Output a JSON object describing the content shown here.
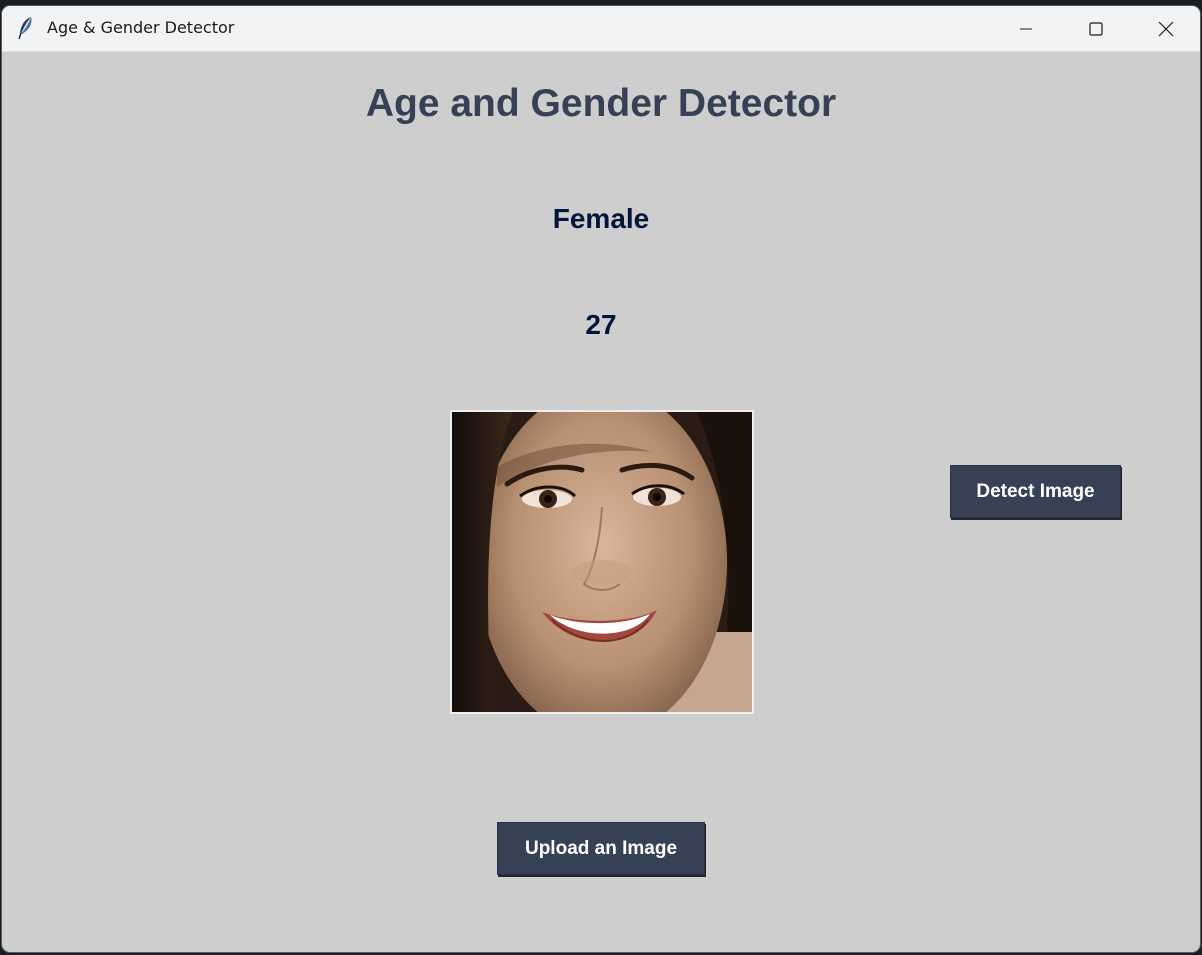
{
  "window": {
    "title": "Age & Gender Detector",
    "icon": "feather-icon",
    "controls": {
      "minimize_icon": "minimize-icon",
      "maximize_icon": "maximize-icon",
      "close_icon": "close-icon"
    }
  },
  "main": {
    "heading": "Age and Gender Detector",
    "gender_result": "Female",
    "age_result": "27",
    "detect_button_label": "Detect Image",
    "upload_button_label": "Upload an Image"
  },
  "colors": {
    "background": "#cecece",
    "heading": "#364156",
    "result_text": "#011638",
    "button": "#364156",
    "button_text": "#ffffff"
  }
}
